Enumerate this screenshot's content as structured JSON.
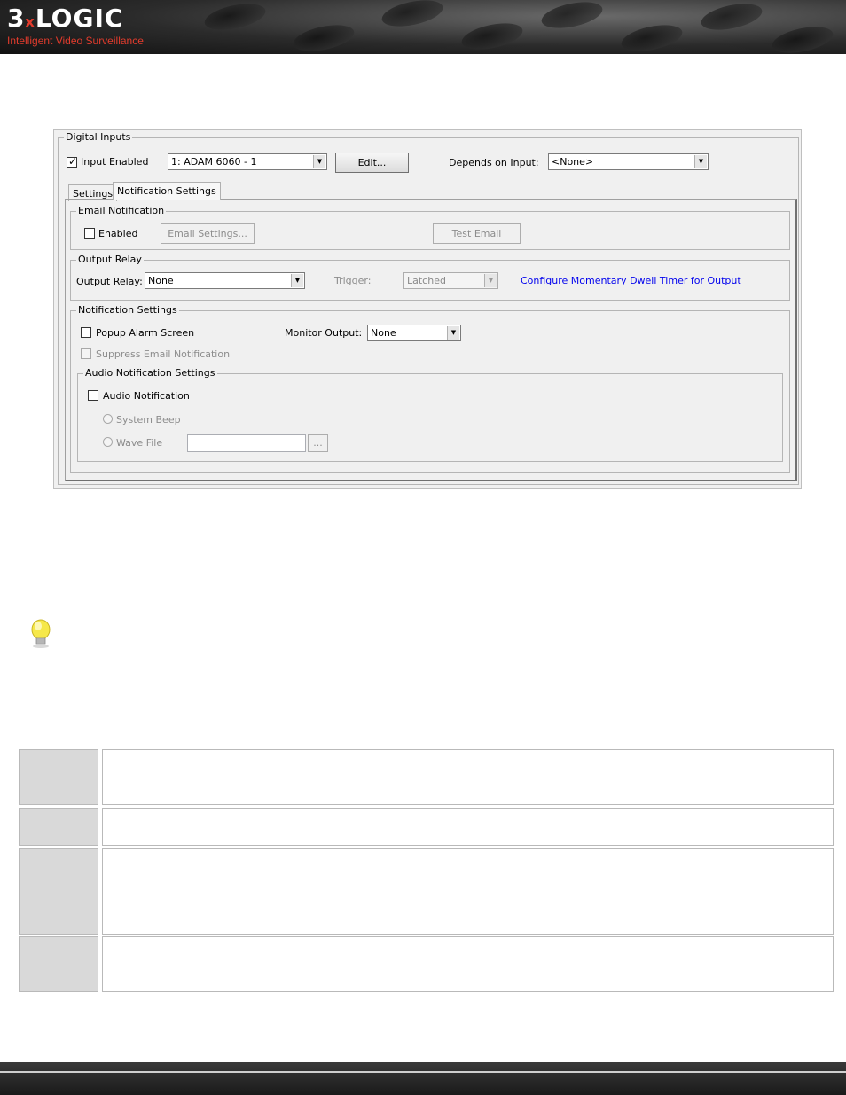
{
  "header": {
    "logo": "3xLOGIC",
    "tagline": "Intelligent Video Surveillance"
  },
  "dialog": {
    "digital_inputs": {
      "legend": "Digital Inputs",
      "input_enabled_label": "Input Enabled",
      "input_enabled_checked": true,
      "input_select_value": "1: ADAM 6060 - 1",
      "edit_button": "Edit...",
      "depends_on_label": "Depends on Input:",
      "depends_on_value": "<None>"
    },
    "tabs": [
      {
        "label": "Settings",
        "active": false
      },
      {
        "label": "Notification Settings",
        "active": true
      }
    ],
    "email_notification": {
      "legend": "Email Notification",
      "enabled_label": "Enabled",
      "email_settings_button": "Email Settings...",
      "test_email_button": "Test Email"
    },
    "output_relay": {
      "legend": "Output Relay",
      "relay_label": "Output Relay:",
      "relay_value": "None",
      "trigger_label": "Trigger:",
      "trigger_value": "Latched",
      "configure_link": "Configure Momentary Dwell Timer for Output"
    },
    "notification_settings": {
      "legend": "Notification Settings",
      "popup_label": "Popup Alarm Screen",
      "monitor_output_label": "Monitor Output:",
      "monitor_output_value": "None",
      "suppress_email_label": "Suppress Email Notification"
    },
    "audio_notification": {
      "legend": "Audio Notification Settings",
      "audio_label": "Audio Notification",
      "system_beep_label": "System Beep",
      "wave_file_label": "Wave File",
      "browse_button": "..."
    }
  },
  "colors": {
    "brand_red": "#e23b2c",
    "link_blue": "#0000ee",
    "table_label_bg": "#d9d9d9"
  }
}
